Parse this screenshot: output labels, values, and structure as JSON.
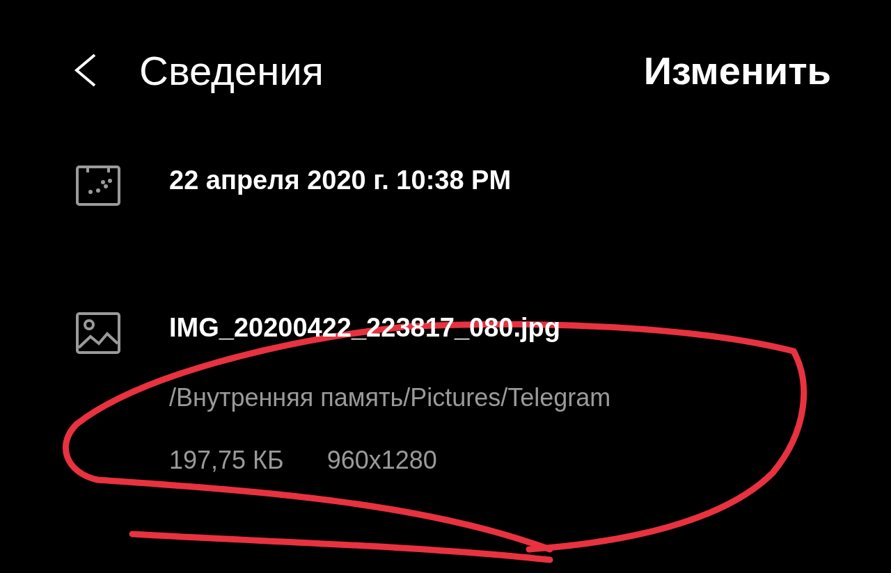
{
  "header": {
    "title": "Сведения",
    "action": "Изменить"
  },
  "rows": [
    {
      "kind": "date",
      "text": "22 апреля 2020 г. 10:38 PM"
    },
    {
      "kind": "file",
      "text": "IMG_20200422_223817_080.jpg",
      "path": "/Внутренняя память/Pictures/Telegram",
      "size": "197,75 КБ",
      "resolution": "960x1280"
    }
  ],
  "annotation": {
    "color": "#e8323f"
  }
}
